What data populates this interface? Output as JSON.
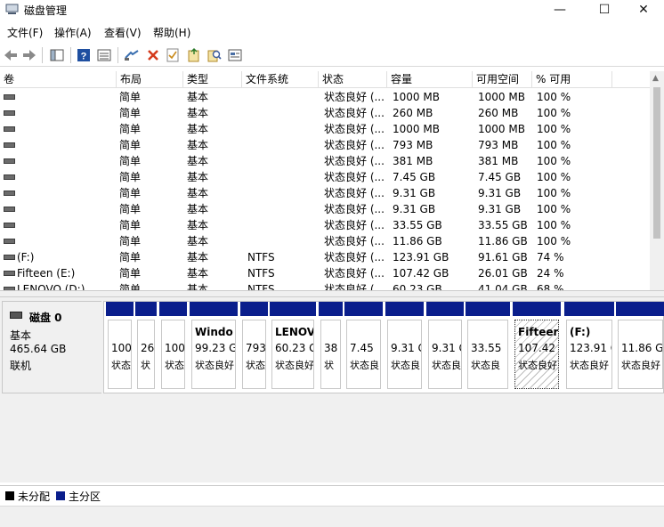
{
  "window": {
    "title": "磁盘管理",
    "minimize": "—",
    "maximize": "☐",
    "close": "✕"
  },
  "menu": [
    {
      "label": "文件(F)"
    },
    {
      "label": "操作(A)"
    },
    {
      "label": "查看(V)"
    },
    {
      "label": "帮助(H)"
    }
  ],
  "toolbar": {
    "icons": [
      "back-arrow-icon",
      "forward-arrow-icon",
      "console-tree-icon",
      "help-icon",
      "properties-list-icon",
      "connect-icon",
      "delete-icon",
      "check-icon",
      "folder-open-icon",
      "search-icon",
      "rescan-icon"
    ]
  },
  "columns": [
    "卷",
    "布局",
    "类型",
    "文件系统",
    "状态",
    "容量",
    "可用空间",
    "% 可用"
  ],
  "volumes": [
    {
      "name": "",
      "layout": "简单",
      "type": "基本",
      "fs": "",
      "status": "状态良好 (...",
      "capacity": "1000 MB",
      "free": "1000 MB",
      "pct": "100 %"
    },
    {
      "name": "",
      "layout": "简单",
      "type": "基本",
      "fs": "",
      "status": "状态良好 (...",
      "capacity": "260 MB",
      "free": "260 MB",
      "pct": "100 %"
    },
    {
      "name": "",
      "layout": "简单",
      "type": "基本",
      "fs": "",
      "status": "状态良好 (...",
      "capacity": "1000 MB",
      "free": "1000 MB",
      "pct": "100 %"
    },
    {
      "name": "",
      "layout": "简单",
      "type": "基本",
      "fs": "",
      "status": "状态良好 (...",
      "capacity": "793 MB",
      "free": "793 MB",
      "pct": "100 %"
    },
    {
      "name": "",
      "layout": "简单",
      "type": "基本",
      "fs": "",
      "status": "状态良好 (...",
      "capacity": "381 MB",
      "free": "381 MB",
      "pct": "100 %"
    },
    {
      "name": "",
      "layout": "简单",
      "type": "基本",
      "fs": "",
      "status": "状态良好 (...",
      "capacity": "7.45 GB",
      "free": "7.45 GB",
      "pct": "100 %"
    },
    {
      "name": "",
      "layout": "简单",
      "type": "基本",
      "fs": "",
      "status": "状态良好 (...",
      "capacity": "9.31 GB",
      "free": "9.31 GB",
      "pct": "100 %"
    },
    {
      "name": "",
      "layout": "简单",
      "type": "基本",
      "fs": "",
      "status": "状态良好 (...",
      "capacity": "9.31 GB",
      "free": "9.31 GB",
      "pct": "100 %"
    },
    {
      "name": "",
      "layout": "简单",
      "type": "基本",
      "fs": "",
      "status": "状态良好 (...",
      "capacity": "33.55 GB",
      "free": "33.55 GB",
      "pct": "100 %"
    },
    {
      "name": "",
      "layout": "简单",
      "type": "基本",
      "fs": "",
      "status": "状态良好 (...",
      "capacity": "11.86 GB",
      "free": "11.86 GB",
      "pct": "100 %"
    },
    {
      "name": "(F:)",
      "layout": "简单",
      "type": "基本",
      "fs": "NTFS",
      "status": "状态良好 (...",
      "capacity": "123.91 GB",
      "free": "91.61 GB",
      "pct": "74 %"
    },
    {
      "name": "Fifteen (E:)",
      "layout": "简单",
      "type": "基本",
      "fs": "NTFS",
      "status": "状态良好 (...",
      "capacity": "107.42 GB",
      "free": "26.01 GB",
      "pct": "24 %"
    },
    {
      "name": "LENOVO (D:)",
      "layout": "简单",
      "type": "基本",
      "fs": "NTFS",
      "status": "状态良好 (...",
      "capacity": "60.23 GB",
      "free": "41.04 GB",
      "pct": "68 %"
    }
  ],
  "disk": {
    "name": "磁盘 0",
    "type": "基本",
    "size": "465.64 GB",
    "state": "联机"
  },
  "partitions": [
    {
      "name": "",
      "size": "100",
      "status": "状态"
    },
    {
      "name": "",
      "size": "26",
      "status": "状"
    },
    {
      "name": "",
      "size": "100",
      "status": "状态"
    },
    {
      "name": "Windo",
      "size": "99.23 G",
      "status": "状态良好"
    },
    {
      "name": "",
      "size": "793",
      "status": "状态"
    },
    {
      "name": "LENOV",
      "size": "60.23 G",
      "status": "状态良好"
    },
    {
      "name": "",
      "size": "38",
      "status": "状"
    },
    {
      "name": "",
      "size": "7.45",
      "status": "状态良"
    },
    {
      "name": "",
      "size": "9.31 G",
      "status": "状态良"
    },
    {
      "name": "",
      "size": "9.31 G",
      "status": "状态良"
    },
    {
      "name": "",
      "size": "33.55",
      "status": "状态良"
    },
    {
      "name": "Fifteen",
      "size": "107.42",
      "status": "状态良好"
    },
    {
      "name": "(F:)",
      "size": "123.91 G",
      "status": "状态良好"
    },
    {
      "name": "",
      "size": "11.86 G",
      "status": "状态良好"
    }
  ],
  "legend": [
    {
      "label": "未分配",
      "color": "#000000"
    },
    {
      "label": "主分区",
      "color": "#0a1e8c"
    }
  ],
  "colors": {
    "primary_partition": "#0a1e8c",
    "unallocated": "#000000"
  }
}
